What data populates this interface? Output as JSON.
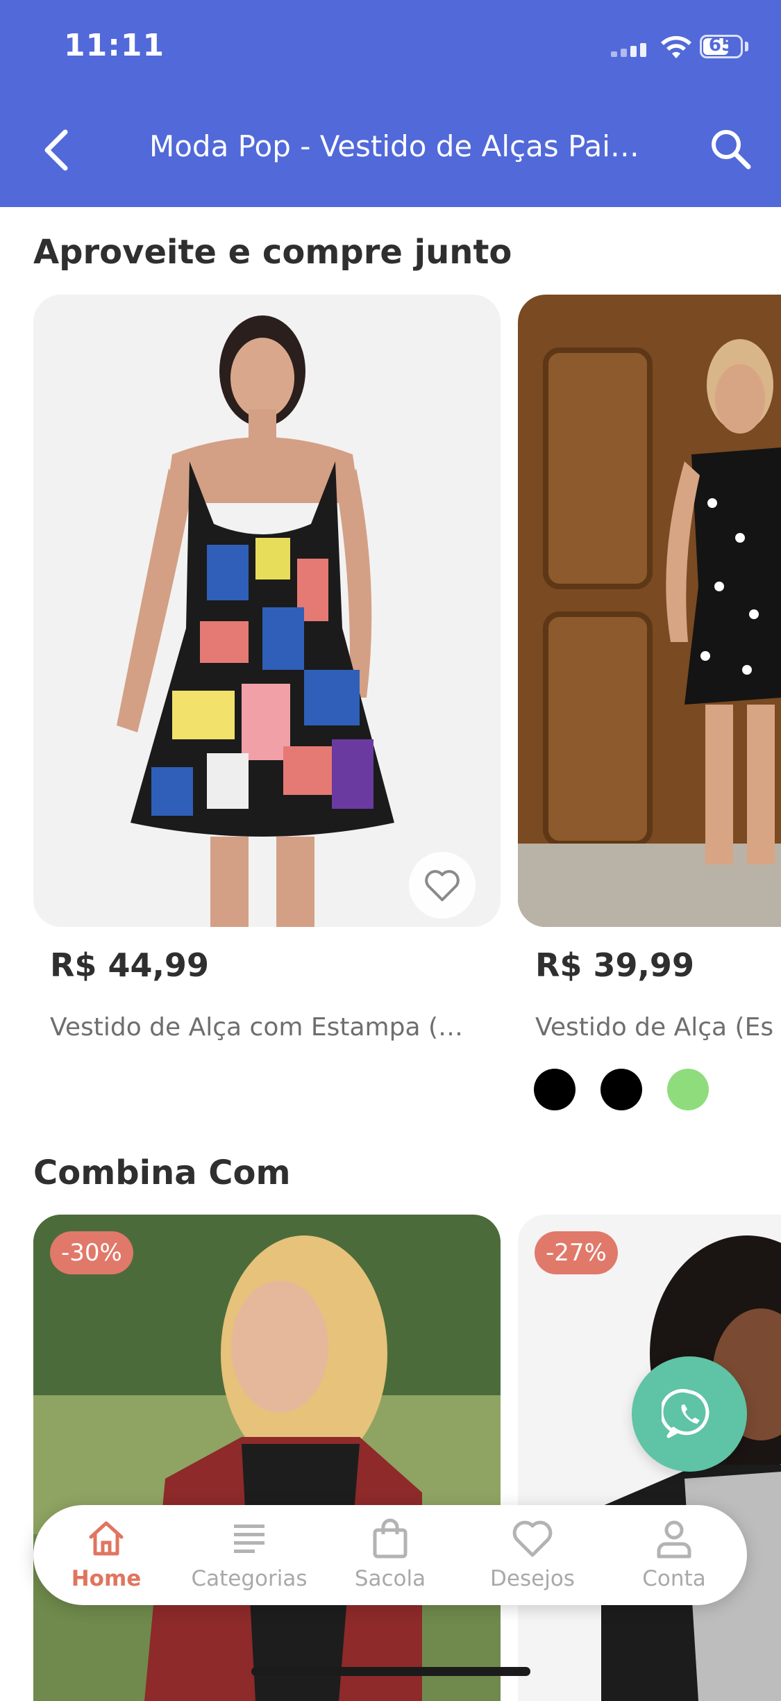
{
  "status": {
    "time": "11:11",
    "battery": "65"
  },
  "nav": {
    "title": "Moda Pop - Vestido de Alças Pai…"
  },
  "sections": {
    "compre_junto": {
      "title": "Aproveite e compre junto"
    },
    "combina": {
      "title": "Combina Com"
    }
  },
  "products": [
    {
      "price": "R$ 44,99",
      "name": "Vestido de Alça com Estampa (…"
    },
    {
      "price": "R$ 39,99",
      "name": "Vestido de Alça (Es",
      "swatches": [
        "#000000",
        "#000000",
        "#8fdc7c"
      ]
    }
  ],
  "combina": [
    {
      "badge": "-30%"
    },
    {
      "badge": "-27%"
    }
  ],
  "tabbar": {
    "items": [
      {
        "label": "Home",
        "icon": "home-icon",
        "active": true
      },
      {
        "label": "Categorias",
        "icon": "list-icon"
      },
      {
        "label": "Sacola",
        "icon": "bag-icon"
      },
      {
        "label": "Desejos",
        "icon": "heart-icon"
      },
      {
        "label": "Conta",
        "icon": "user-icon"
      }
    ]
  },
  "colors": {
    "header": "#5169d9",
    "accent": "#e07560",
    "badge": "#e0796a",
    "whatsapp": "#5fc3a5"
  }
}
